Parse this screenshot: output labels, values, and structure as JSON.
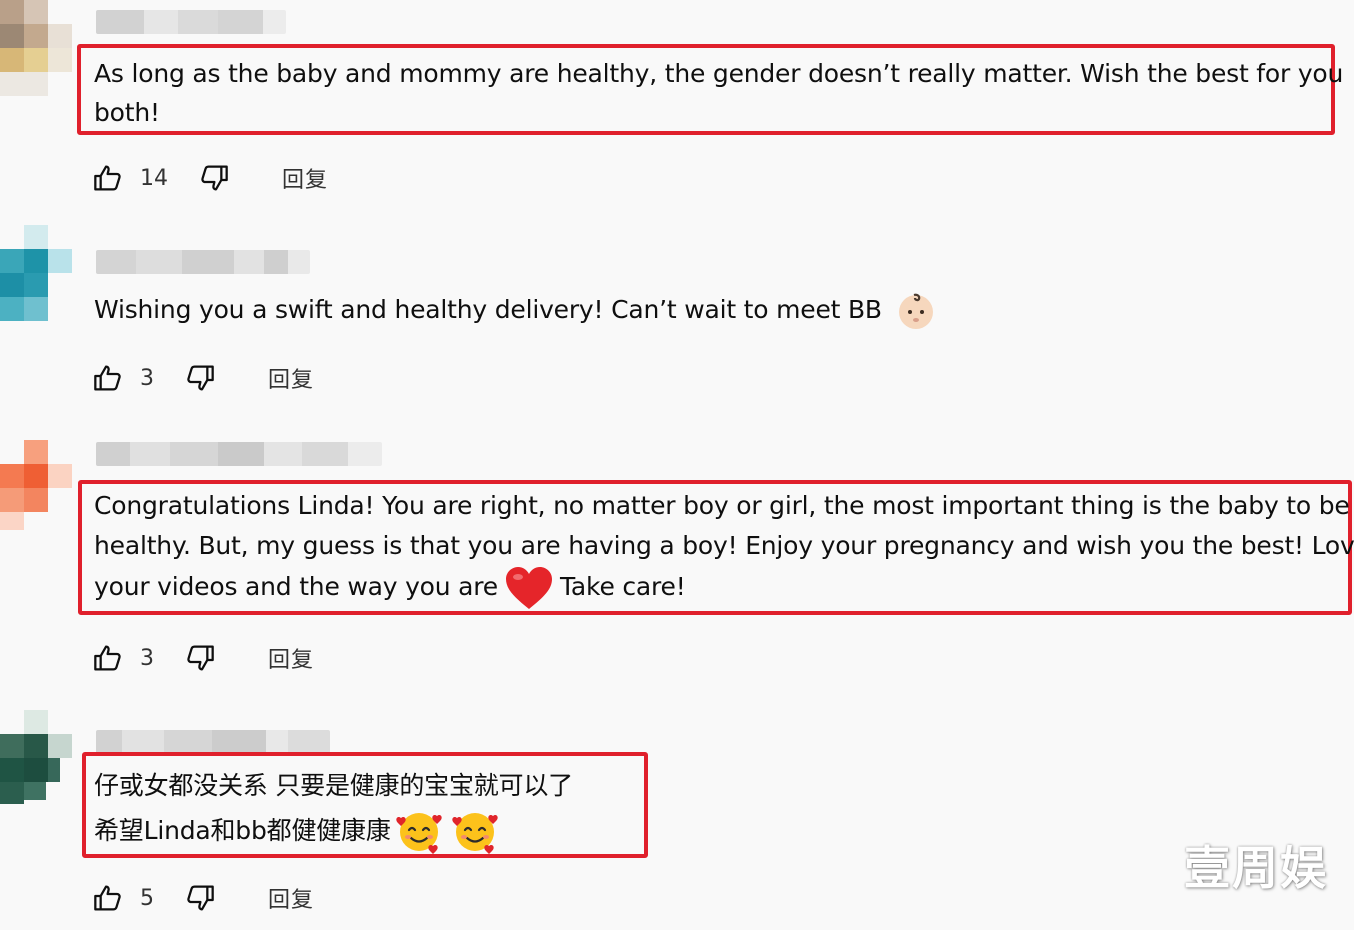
{
  "colors": {
    "highlight": "#e0202c",
    "background": "#f9f9f9"
  },
  "reply_label": "回复",
  "comments": [
    {
      "lines": [
        "As long as the baby and mommy are healthy, the gender doesn’t really matter. Wish the best for you",
        "both!"
      ],
      "likes": "14",
      "highlighted": true
    },
    {
      "lines": [
        "Wishing you a swift and healthy delivery! Can’t wait to meet BB"
      ],
      "emoji": "baby-emoji",
      "likes": "3",
      "highlighted": false
    },
    {
      "lines": [
        "Congratulations Linda! You are right, no matter boy or girl, the most important thing is the baby to be",
        "healthy. But, my guess is that you are having a boy! Enjoy your pregnancy and wish you the best! Love",
        "your videos and the way you are",
        "Take care!"
      ],
      "emoji": "red-heart-emoji",
      "likes": "3",
      "highlighted": true
    },
    {
      "lines": [
        "仔或女都没关系  只要是健康的宝宝就可以了",
        "希望Linda和bb都健健康康"
      ],
      "emoji": "smiling-face-with-hearts-emoji",
      "likes": "5",
      "highlighted": true
    }
  ],
  "watermark": "壹周娱"
}
